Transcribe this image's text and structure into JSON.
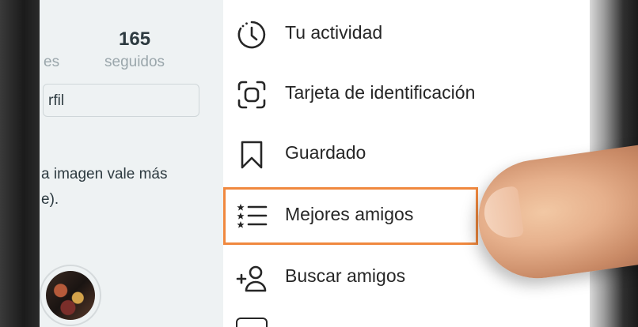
{
  "profile": {
    "following_count": "165",
    "following_label": "seguidos",
    "followers_label_partial": "es",
    "edit_button_partial": "rfil",
    "bio_line1": "a imagen vale más",
    "bio_line2": "e)."
  },
  "menu": {
    "items": [
      {
        "label": "Tu actividad",
        "icon": "activity-clock-icon"
      },
      {
        "label": "Tarjeta de identificación",
        "icon": "nametag-scan-icon"
      },
      {
        "label": "Guardado",
        "icon": "bookmark-icon"
      },
      {
        "label": "Mejores amigos",
        "icon": "close-friends-list-icon"
      },
      {
        "label": "Buscar amigos",
        "icon": "add-person-icon"
      }
    ]
  },
  "colors": {
    "focus_outline": "#f0883e",
    "text": "#262626",
    "dimmed_panel": "#eef2f3"
  }
}
